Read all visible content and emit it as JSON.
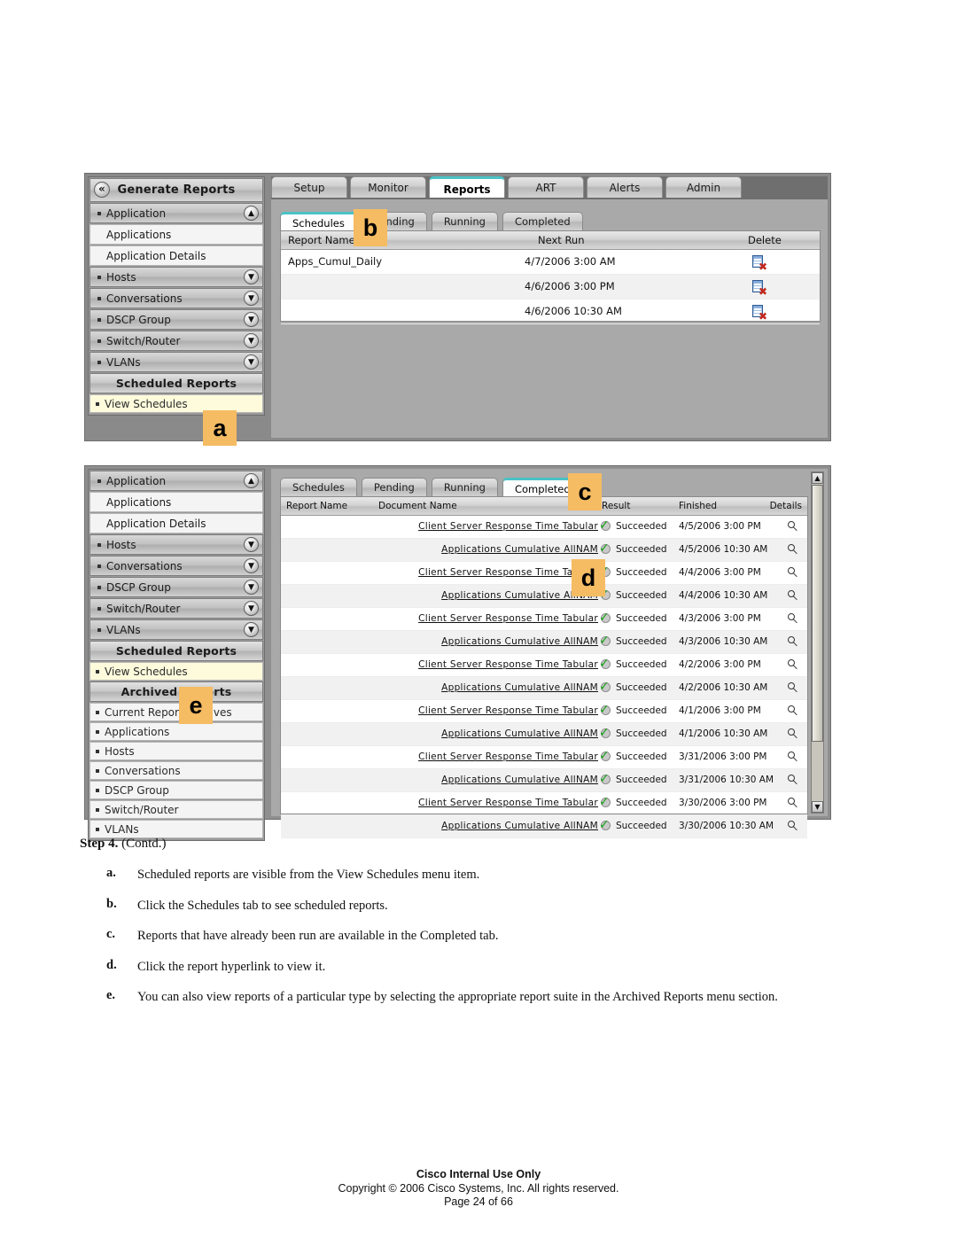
{
  "document": {
    "step_label": "Step 4.",
    "step_contd": "(Contd.)",
    "substeps": [
      {
        "label": "a.",
        "text": "Scheduled reports are visible from the View Schedules menu item."
      },
      {
        "label": "b.",
        "text": "Click the Schedules tab to see scheduled reports."
      },
      {
        "label": "c.",
        "text": "Reports that have already been run are available in the Completed tab."
      },
      {
        "label": "d.",
        "text": "Click the report hyperlink to view it."
      },
      {
        "label": "e.",
        "text": "You can also view reports of a particular type by selecting the appropriate report suite in the Archived Reports menu section."
      }
    ]
  },
  "footer": {
    "line1": "Cisco Internal Use Only",
    "line2": "Copyright © 2006 Cisco Systems, Inc. All rights reserved.",
    "line3": "Page 24 of 66"
  },
  "callouts": {
    "a": "a",
    "b": "b",
    "c": "c",
    "d": "d",
    "e": "e"
  },
  "colors": {
    "callout_bg": "#f5bc63",
    "active_tab_accent": "#49c2c6",
    "selected_nav_bg": "#fdfbdc",
    "success_green": "#18a318",
    "delete_red": "#c3281e"
  },
  "screenshot1": {
    "nav": {
      "title": "Generate Reports",
      "collapse_icon": "collapse-left-icon",
      "groups": [
        {
          "label": "Application",
          "chevron": "chevron-up-icon"
        },
        {
          "label": "Hosts",
          "chevron": "chevron-down-icon"
        },
        {
          "label": "Conversations",
          "chevron": "chevron-down-icon"
        },
        {
          "label": "DSCP Group",
          "chevron": "chevron-down-icon"
        },
        {
          "label": "Switch/Router",
          "chevron": "chevron-down-icon"
        },
        {
          "label": "VLANs",
          "chevron": "chevron-down-icon"
        }
      ],
      "app_children": [
        "Applications",
        "Application Details"
      ],
      "section_title": "Scheduled Reports",
      "section_items": [
        "View Schedules"
      ]
    },
    "main_tabs": [
      {
        "label": "Setup",
        "active": false
      },
      {
        "label": "Monitor",
        "active": false
      },
      {
        "label": "Reports",
        "active": true
      },
      {
        "label": "ART",
        "active": false
      },
      {
        "label": "Alerts",
        "active": false
      },
      {
        "label": "Admin",
        "active": false
      }
    ],
    "sub_tabs": [
      {
        "label": "Schedules",
        "active": true
      },
      {
        "label": "Pending",
        "active": false
      },
      {
        "label": "Running",
        "active": false
      },
      {
        "label": "Completed",
        "active": false
      }
    ],
    "table": {
      "columns": [
        "Report Name",
        "Next Run",
        "Delete"
      ],
      "rows": [
        {
          "report_name": "Apps_Cumul_Daily",
          "next_run": "4/7/2006 3:00 AM",
          "delete_icon": "delete-report-icon"
        },
        {
          "report_name": "",
          "next_run": "4/6/2006 3:00 PM",
          "delete_icon": "delete-report-icon"
        },
        {
          "report_name": "",
          "next_run": "4/6/2006 10:30 AM",
          "delete_icon": "delete-report-icon"
        }
      ]
    }
  },
  "screenshot2": {
    "nav": {
      "groups": [
        {
          "label": "Application",
          "chevron": "chevron-up-icon"
        },
        {
          "label": "Hosts",
          "chevron": "chevron-down-icon"
        },
        {
          "label": "Conversations",
          "chevron": "chevron-down-icon"
        },
        {
          "label": "DSCP Group",
          "chevron": "chevron-down-icon"
        },
        {
          "label": "Switch/Router",
          "chevron": "chevron-down-icon"
        },
        {
          "label": "VLANs",
          "chevron": "chevron-down-icon"
        }
      ],
      "app_children": [
        "Applications",
        "Application Details"
      ],
      "scheduled_title": "Scheduled Reports",
      "scheduled_items": [
        "View Schedules"
      ],
      "archived_title": "Archived Reports",
      "archived_items": [
        "Current Report Archives",
        "Applications",
        "Hosts",
        "Conversations",
        "DSCP Group",
        "Switch/Router",
        "VLANs"
      ]
    },
    "sub_tabs": [
      {
        "label": "Schedules",
        "active": false
      },
      {
        "label": "Pending",
        "active": false
      },
      {
        "label": "Running",
        "active": false
      },
      {
        "label": "Completed",
        "active": true
      }
    ],
    "table": {
      "columns": [
        "Report Name",
        "Document Name",
        "Result",
        "Finished",
        "Details"
      ],
      "rows": [
        {
          "report_name": "",
          "document_name": "Client Server Response Time Tabular",
          "result": "Succeeded",
          "finished": "4/5/2006 3:00 PM"
        },
        {
          "report_name": "",
          "document_name": "Applications Cumulative AllNAM",
          "result": "Succeeded",
          "finished": "4/5/2006 10:30 AM"
        },
        {
          "report_name": "",
          "document_name": "Client Server Response Time Tabular",
          "result": "Succeeded",
          "finished": "4/4/2006 3:00 PM"
        },
        {
          "report_name": "",
          "document_name": "Applications Cumulative AllNAM",
          "result": "Succeeded",
          "finished": "4/4/2006 10:30 AM"
        },
        {
          "report_name": "",
          "document_name": "Client Server Response Time Tabular",
          "result": "Succeeded",
          "finished": "4/3/2006 3:00 PM"
        },
        {
          "report_name": "",
          "document_name": "Applications Cumulative AllNAM",
          "result": "Succeeded",
          "finished": "4/3/2006 10:30 AM"
        },
        {
          "report_name": "",
          "document_name": "Client Server Response Time Tabular",
          "result": "Succeeded",
          "finished": "4/2/2006 3:00 PM"
        },
        {
          "report_name": "",
          "document_name": "Applications Cumulative AllNAM",
          "result": "Succeeded",
          "finished": "4/2/2006 10:30 AM"
        },
        {
          "report_name": "",
          "document_name": "Client Server Response Time Tabular",
          "result": "Succeeded",
          "finished": "4/1/2006 3:00 PM"
        },
        {
          "report_name": "",
          "document_name": "Applications Cumulative AllNAM",
          "result": "Succeeded",
          "finished": "4/1/2006 10:30 AM"
        },
        {
          "report_name": "",
          "document_name": "Client Server Response Time Tabular",
          "result": "Succeeded",
          "finished": "3/31/2006 3:00 PM"
        },
        {
          "report_name": "",
          "document_name": "Applications Cumulative AllNAM",
          "result": "Succeeded",
          "finished": "3/31/2006 10:30 AM"
        },
        {
          "report_name": "",
          "document_name": "Client Server Response Time Tabular",
          "result": "Succeeded",
          "finished": "3/30/2006 3:00 PM"
        },
        {
          "report_name": "",
          "document_name": "Applications Cumulative AllNAM",
          "result": "Succeeded",
          "finished": "3/30/2006 10:30 AM"
        }
      ]
    },
    "scrollbar": {
      "up_icon": "scroll-up-icon",
      "down_icon": "scroll-down-icon"
    }
  }
}
